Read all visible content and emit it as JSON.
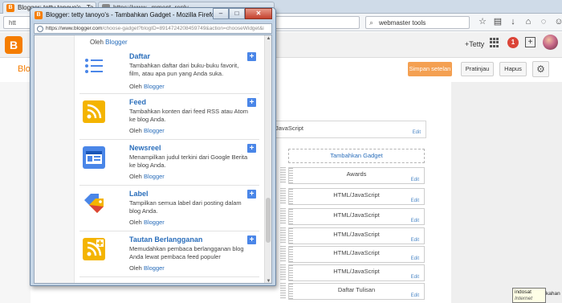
{
  "background_browser": {
    "tabs": [
      {
        "label": "Blogger: tetty tanoyo's - Ta...",
        "active": true
      },
      {
        "label": "https://www...mment_reply",
        "active": false
      }
    ],
    "url": "htt",
    "search_value": "webmaster tools"
  },
  "blogger": {
    "logo_letter": "B",
    "user_name": "+Tetty",
    "notification_count": "1",
    "blog_label": "Blo",
    "buttons": {
      "save": "Simpan setelan",
      "preview": "Pratinjau",
      "delete": "Hapus"
    },
    "top_gadget_label": "JavaScript",
    "top_gadget_edit": "Edit",
    "add_gadget_label": "Tambahkan Gadget",
    "widgets": [
      {
        "title": "Awards",
        "edit": "Edit"
      },
      {
        "title": "HTML/JavaScript",
        "edit": "Edit"
      },
      {
        "title": "HTML/JavaScript",
        "edit": "Edit"
      },
      {
        "title": "HTML/JavaScript",
        "edit": "Edit"
      },
      {
        "title": "HTML/JavaScript",
        "edit": "Edit"
      },
      {
        "title": "HTML/JavaScript",
        "edit": "Edit"
      },
      {
        "title": "Daftar Tulisan",
        "edit": "Edit"
      }
    ]
  },
  "tooltip": {
    "line1": "indosat",
    "line2": "Internet access",
    "tray_label": "kahan"
  },
  "popup": {
    "title": "Blogger: tetty tanoyo's - Tambahkan Gadget - Mozilla Firefox",
    "url_main": "https://www.blogger.com",
    "url_rest": "/choose-gadget?blogID=8914724208459749&action=chooseWidget&i",
    "top_by_prefix": "Oleh ",
    "top_by_link": "Blogger",
    "gadgets": [
      {
        "name": "Daftar",
        "desc": "Tambahkan daftar dari buku-buku favorit, film, atau apa pun yang Anda suka.",
        "by_prefix": "Oleh ",
        "by_link": "Blogger",
        "icon": "list-icon",
        "add": "+"
      },
      {
        "name": "Feed",
        "desc": "Tambahkan konten dari feed RSS atau Atom ke blog Anda.",
        "by_prefix": "Oleh ",
        "by_link": "Blogger",
        "icon": "rss-icon",
        "add": "+"
      },
      {
        "name": "Newsreel",
        "desc": "Menampilkan judul terkini dari Google Berita ke blog Anda.",
        "by_prefix": "Oleh ",
        "by_link": "Blogger",
        "icon": "newsreel-icon",
        "add": "+"
      },
      {
        "name": "Label",
        "desc": "Tampilkan semua label dari posting dalam blog Anda.",
        "by_prefix": "Oleh ",
        "by_link": "Blogger",
        "icon": "label-icon",
        "add": "+"
      },
      {
        "name": "Tautan Berlangganan",
        "desc": "Memudahkan pembaca berlangganan blog Anda lewat pembaca feed populer",
        "by_prefix": "Oleh ",
        "by_link": "Blogger",
        "icon": "subscribe-rss-icon",
        "add": "+"
      }
    ]
  },
  "colors": {
    "blogger_orange": "#f57d00",
    "link_blue": "#2a6ebb",
    "add_button_blue": "#4a86e8",
    "save_button": "#f4a052"
  }
}
